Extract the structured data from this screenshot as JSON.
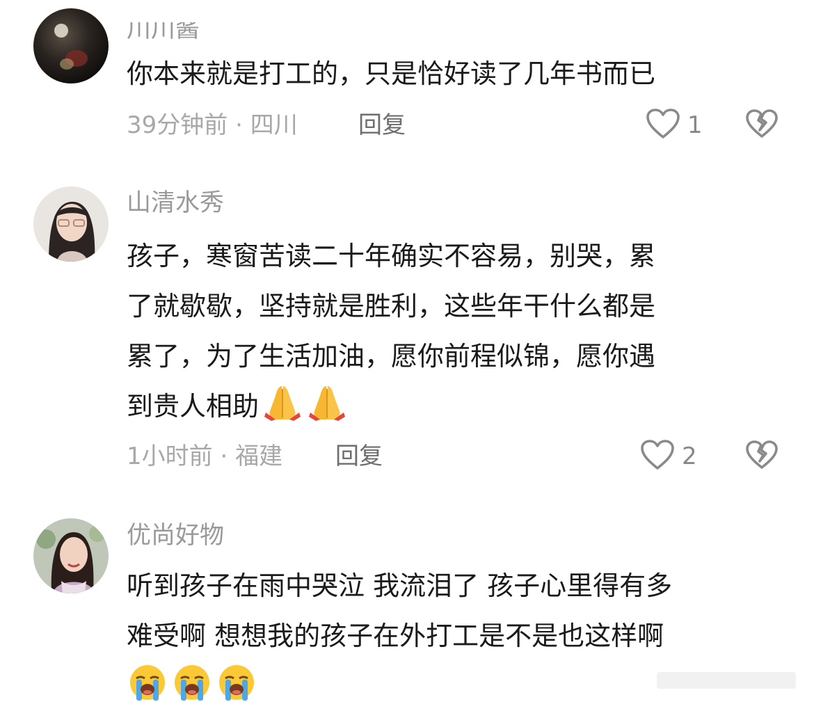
{
  "comments": [
    {
      "username": "川川酱",
      "text_lines": [
        "你本来就是打工的，只是恰好读了几年书而已"
      ],
      "time": "39分钟前",
      "location": "四川",
      "separator": " · ",
      "reply_label": "回复",
      "likes": "1"
    },
    {
      "username": "山清水秀",
      "text_lines": [
        "孩子，寒窗苦读二十年确实不容易，别哭，累",
        "了就歇歇，坚持就是胜利，这些年干什么都是",
        "累了，为了生活加油，愿你前程似锦，愿你遇",
        "到贵人相助"
      ],
      "emojis": [
        "folded-hands",
        "folded-hands"
      ],
      "time": "1小时前",
      "location": "福建",
      "separator": " · ",
      "reply_label": "回复",
      "likes": "2"
    },
    {
      "username": "优尚好物",
      "text_lines": [
        "听到孩子在雨中哭泣 我流泪了 孩子心里得有多",
        "难受啊 想想我的孩子在外打工是不是也这样啊"
      ],
      "emojis": [
        "loudly-crying-face",
        "loudly-crying-face",
        "loudly-crying-face"
      ]
    }
  ],
  "icons": {
    "like": "heart-outline-icon",
    "dislike": "broken-heart-icon"
  },
  "colors": {
    "username": "#9a9a9a",
    "text": "#1a1a1a",
    "meta": "#a8a8a8",
    "icon": "#8a8a8a"
  }
}
